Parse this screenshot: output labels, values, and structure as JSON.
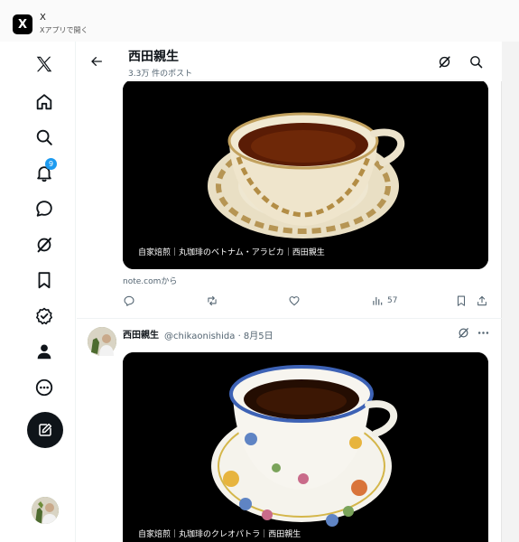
{
  "app": {
    "icon_glyph": "X",
    "title": "X",
    "subtitle": "Xアプリで開く"
  },
  "nav": {
    "items": [
      {
        "icon": "x-logo-icon"
      },
      {
        "icon": "home-icon"
      },
      {
        "icon": "search-icon"
      },
      {
        "icon": "bell-icon",
        "badge": "9"
      },
      {
        "icon": "chat-bubble-icon"
      },
      {
        "icon": "grok-icon"
      },
      {
        "icon": "bookmark-icon"
      },
      {
        "icon": "verified-icon"
      },
      {
        "icon": "profile-icon"
      },
      {
        "icon": "more-icon"
      }
    ],
    "compose_icon": "compose-icon"
  },
  "header": {
    "name": "西田親生",
    "post_count": "3.3万 件のポスト"
  },
  "tweet1": {
    "media_caption": "自家焙煎｜丸珈琲のベトナム・アラビカ｜西田親生",
    "link_source": "note.comから",
    "actions": {
      "reply_count": "",
      "retweet_count": "",
      "like_count": "",
      "views_count": "57"
    }
  },
  "tweet2": {
    "display_name": "西田親生",
    "handle_date": "@chikaonishida · 8月5日",
    "media_caption": "自家焙煎｜丸珈琲のクレオパトラ｜西田親生"
  },
  "colors": {
    "accent": "#1d9bf0",
    "text": "#0f1419",
    "secondary": "#536471"
  }
}
